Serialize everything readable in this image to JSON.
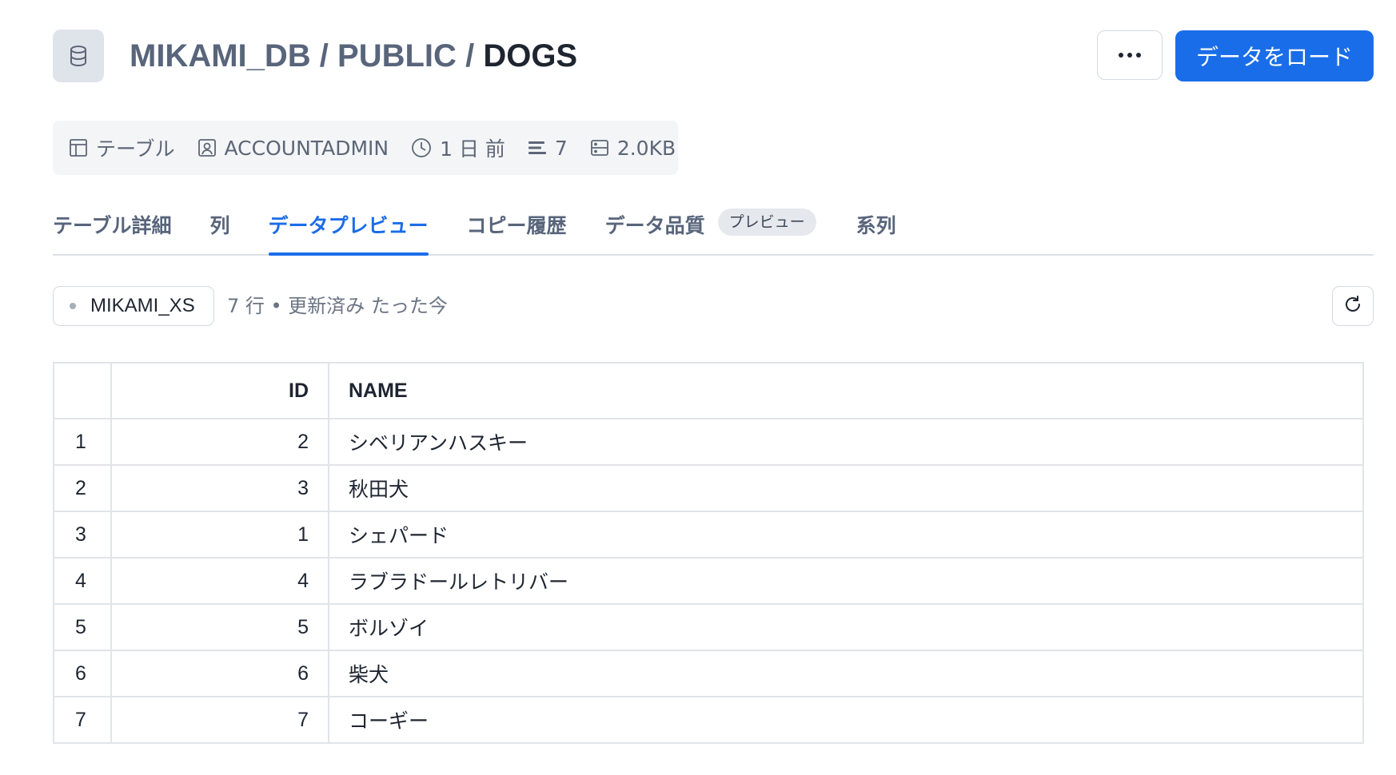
{
  "header": {
    "breadcrumb": [
      "MIKAMI_DB",
      "PUBLIC"
    ],
    "separator": "/",
    "current": "DOGS",
    "load_button": "データをロード"
  },
  "meta": {
    "type": "テーブル",
    "owner": "ACCOUNTADMIN",
    "updated": "1 日 前",
    "rows": "7",
    "size": "2.0KB"
  },
  "tabs": [
    {
      "label": "テーブル詳細"
    },
    {
      "label": "列"
    },
    {
      "label": "データプレビュー"
    },
    {
      "label": "コピー履歴"
    },
    {
      "label": "データ品質",
      "badge": "プレビュー"
    },
    {
      "label": "系列"
    }
  ],
  "preview": {
    "warehouse": "MIKAMI_XS",
    "info": "7 行 • 更新済み たった今"
  },
  "table": {
    "columns": [
      "",
      "ID",
      "NAME"
    ],
    "rows": [
      [
        "1",
        "2",
        "シベリアンハスキー"
      ],
      [
        "2",
        "3",
        "秋田犬"
      ],
      [
        "3",
        "1",
        "シェパード"
      ],
      [
        "4",
        "4",
        "ラブラドールレトリバー"
      ],
      [
        "5",
        "5",
        "ボルゾイ"
      ],
      [
        "6",
        "6",
        "柴犬"
      ],
      [
        "7",
        "7",
        "コーギー"
      ]
    ]
  },
  "colors": {
    "accent": "#1a6de8",
    "muted_text": "#58657b",
    "border": "#e1e4e9"
  },
  "icons": [
    "database-icon",
    "more-icon",
    "table-icon",
    "user-icon",
    "clock-icon",
    "rows-icon",
    "storage-icon",
    "refresh-icon"
  ]
}
